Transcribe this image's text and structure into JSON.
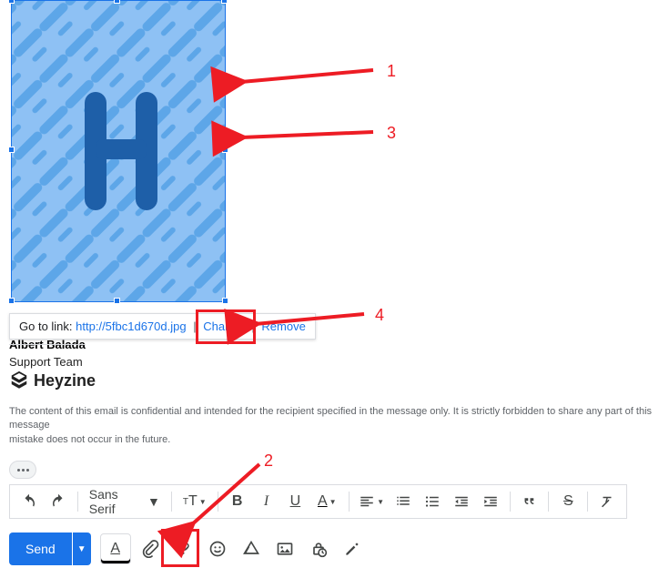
{
  "image": {
    "letter": "H"
  },
  "link_popup": {
    "label": "Go to link:",
    "url": "http://5fbc1d670d.jpg",
    "change": "Change",
    "remove": "Remove",
    "sep": "|"
  },
  "signature": {
    "name": "Albert Balada",
    "role": "Support Team",
    "brand": "Heyzine"
  },
  "disclaimer": {
    "line1": "The content of this email is confidential and intended for the recipient specified in the message only. It is strictly forbidden to share any part of this message",
    "line2": "mistake does not occur in the future."
  },
  "toolbar": {
    "font": "Sans Serif"
  },
  "send": {
    "label": "Send"
  },
  "annotations": {
    "n1": "1",
    "n2": "2",
    "n3": "3",
    "n4": "4"
  }
}
